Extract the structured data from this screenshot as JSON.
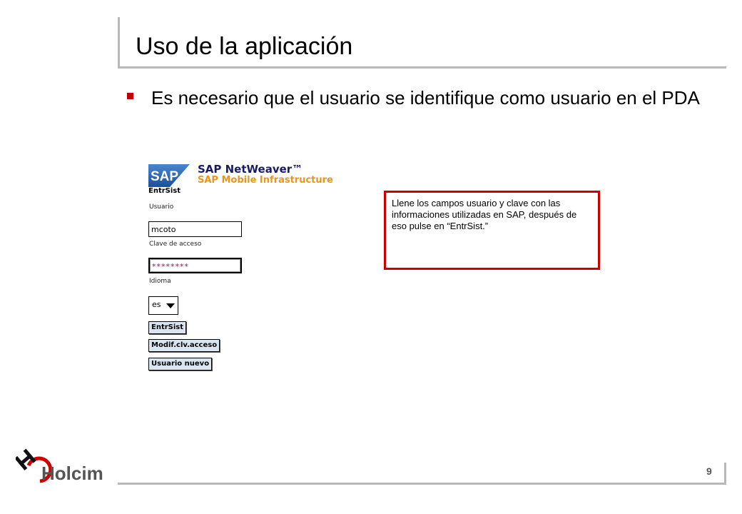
{
  "slide": {
    "title": "Uso de la aplicación",
    "bullet": "Es necesario que el usuario se identifique como usuario en el PDA",
    "page_number": "9"
  },
  "pda_screen": {
    "logo_text": "SAP",
    "product_title": "SAP NetWeaver™",
    "product_subtitle": "SAP Mobile Infrastructure",
    "screen_title": "EntrSist",
    "user_label": "Usuario",
    "user_value": "mcoto",
    "password_label": "Clave de acceso",
    "password_value": "********",
    "language_label": "Idioma",
    "language_value": "es",
    "buttons": {
      "login": "EntrSist",
      "change_password": "Modif.clv.acceso",
      "new_user": "Usuario nuevo"
    }
  },
  "callout": {
    "text": "Llene los campos usuario y clave con las informaciones utilizadas en SAP, después de eso pulse en “EntrSist.”"
  },
  "footer": {
    "brand": "Holcim"
  },
  "colors": {
    "accent_red": "#cc0000",
    "bullet_red": "#c00000",
    "sap_blue": "#1a4f9c",
    "sap_orange": "#e8951a",
    "rule_gray": "#b8b8b8"
  }
}
